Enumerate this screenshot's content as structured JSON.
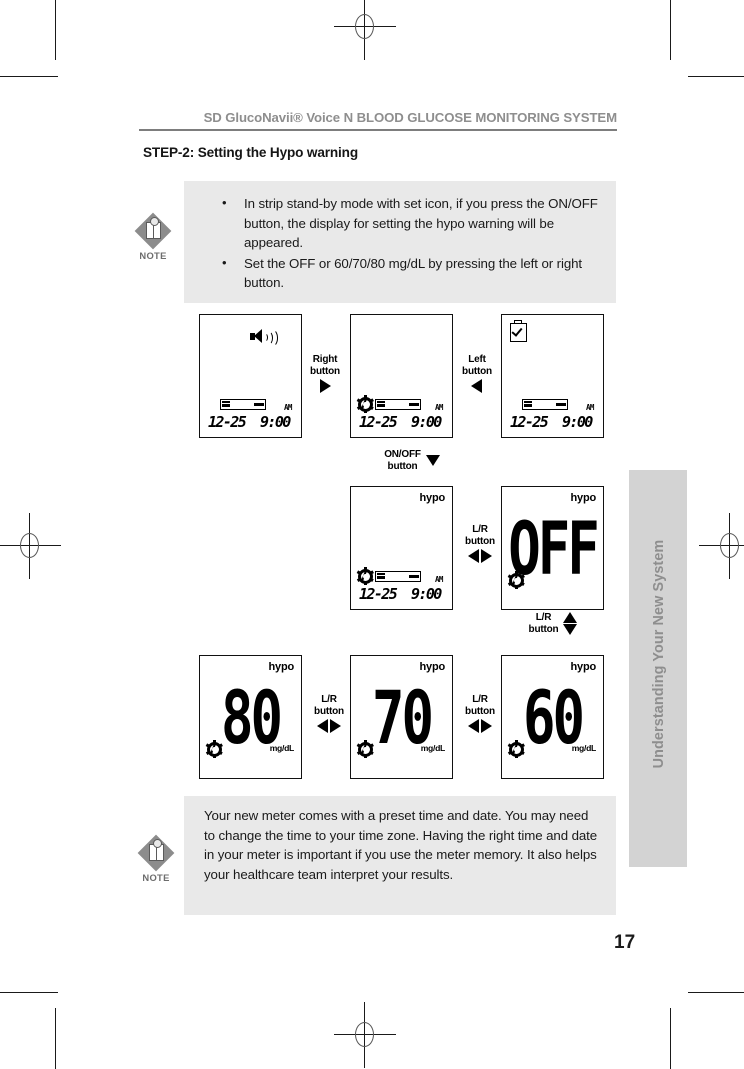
{
  "header": {
    "title": "SD GlucoNavii® Voice N BLOOD GLUCOSE MONITORING SYSTEM"
  },
  "step_title": "STEP-2: Setting the Hypo warning",
  "note_top": {
    "icon_label": "NOTE",
    "bullets": [
      "In strip stand-by mode with set icon, if you press the ON/OFF button, the display for setting the hypo warning will be appeared.",
      "Set the OFF or 60/70/80 mg/dL by pressing the left or right button."
    ]
  },
  "note_bottom": {
    "icon_label": "NOTE",
    "text": "Your new meter comes with a preset time and date. You may need to change the time to your time zone. Having the right time and date in your meter is important if you use the meter memory. It also helps your healthcare team interpret your results."
  },
  "screens": {
    "s1": {
      "date": "12-25",
      "time": "9:00",
      "ampm": "AM"
    },
    "s2": {
      "date": "12-25",
      "time": "9:00",
      "ampm": "AM"
    },
    "s3": {
      "date": "12-25",
      "time": "9:00",
      "ampm": "AM"
    },
    "s4": {
      "hypo": "hypo",
      "date": "12-25",
      "time": "9:00",
      "ampm": "AM"
    },
    "s5": {
      "hypo": "hypo",
      "value": "OFF"
    },
    "s6": {
      "hypo": "hypo",
      "value": "80",
      "unit": "mg/dL"
    },
    "s7": {
      "hypo": "hypo",
      "value": "70",
      "unit": "mg/dL"
    },
    "s8": {
      "hypo": "hypo",
      "value": "60",
      "unit": "mg/dL"
    }
  },
  "callouts": {
    "right_button": "Right\nbutton",
    "right_button_l1": "Right",
    "right_button_l2": "button",
    "left_button_l1": "Left",
    "left_button_l2": "button",
    "onoff_l1": "ON/OFF",
    "onoff_l2": "button",
    "lr_l1": "L/R",
    "lr_l2": "button"
  },
  "side_tab": "Understanding Your New System",
  "page_number": "17"
}
